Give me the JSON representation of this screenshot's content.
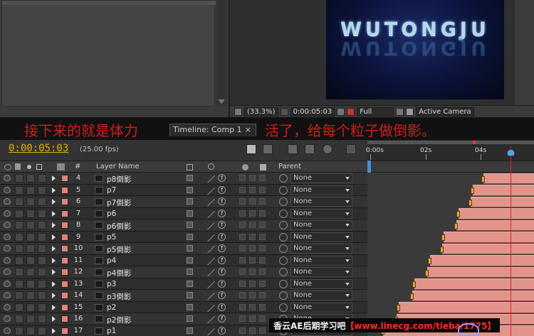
{
  "composition": {
    "preview_title": "WUTONGJU",
    "zoom": "(33.3%)",
    "timecode": "0:00:05:03",
    "resolution": "Full",
    "camera": "Active Camera"
  },
  "annotation": {
    "left_text": "接下来的就是体力",
    "right_text": "活了，给每个粒子做倒影。"
  },
  "timeline": {
    "tab_label": "Timeline: Comp 1",
    "tab_close": "×",
    "current_time": "0:00:05:03",
    "fps": "(25.00 fps)",
    "ruler_ticks": [
      "0:00s",
      "02s",
      "04s"
    ],
    "columns": {
      "hash": "#",
      "layer_name": "Layer Name",
      "parent": "Parent"
    },
    "layers": [
      {
        "num": "4",
        "name": "p8倒影",
        "parent": "None"
      },
      {
        "num": "5",
        "name": "p7",
        "parent": "None"
      },
      {
        "num": "6",
        "name": "p7倒影",
        "parent": "None"
      },
      {
        "num": "7",
        "name": "p6",
        "parent": "None"
      },
      {
        "num": "8",
        "name": "p6倒影",
        "parent": "None"
      },
      {
        "num": "9",
        "name": "p5",
        "parent": "None"
      },
      {
        "num": "10",
        "name": "p5倒影",
        "parent": "None"
      },
      {
        "num": "11",
        "name": "p4",
        "parent": "None"
      },
      {
        "num": "12",
        "name": "p4倒影",
        "parent": "None"
      },
      {
        "num": "13",
        "name": "p3",
        "parent": "None"
      },
      {
        "num": "14",
        "name": "p3倒影",
        "parent": "None"
      },
      {
        "num": "15",
        "name": "p2",
        "parent": "None"
      },
      {
        "num": "16",
        "name": "p2倒影",
        "parent": "None"
      },
      {
        "num": "17",
        "name": "p1",
        "parent": "None"
      }
    ]
  },
  "watermark": {
    "site": "香云AE后期学习吧",
    "url": "【www.linecg.com/tieba/1775】"
  },
  "colors": {
    "timecode": "#e5b000",
    "annotation": "#d21c1c",
    "label": "#e0837a",
    "bar": "#e2948a",
    "playhead": "#e02020"
  }
}
